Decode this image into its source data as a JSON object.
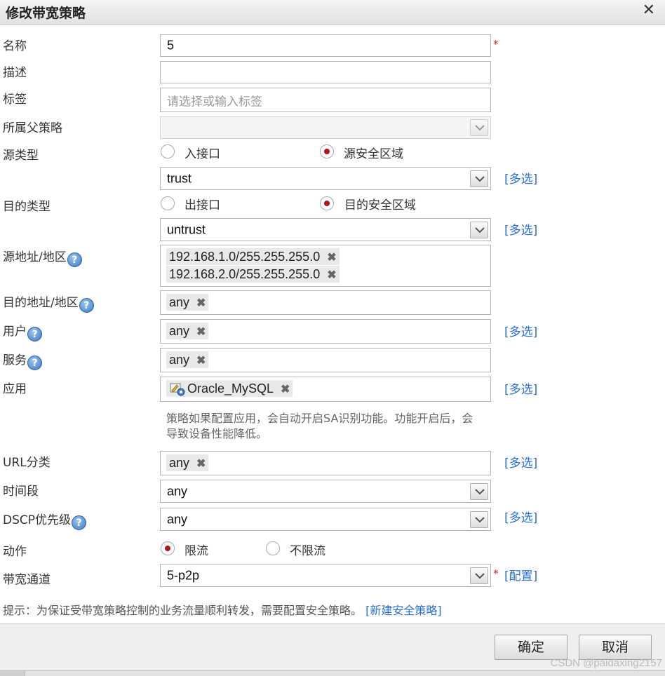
{
  "dialog": {
    "title": "修改带宽策略"
  },
  "labels": {
    "name": "名称",
    "desc": "描述",
    "tags": "标签",
    "parent": "所属父策略",
    "src_type": "源类型",
    "dst_type": "目的类型",
    "src_addr": "源地址/地区",
    "dst_addr": "目的地址/地区",
    "user": "用户",
    "service": "服务",
    "app": "应用",
    "url": "URL分类",
    "time": "时间段",
    "dscp": "DSCP优先级",
    "action": "动作",
    "channel": "带宽通道"
  },
  "fields": {
    "name_value": "5",
    "tags_placeholder": "请选择或输入标签",
    "src_zone": "trust",
    "dst_zone": "untrust",
    "src_addrs": [
      "192.168.1.0/255.255.255.0",
      "192.168.2.0/255.255.255.0"
    ],
    "dst_addr": "any",
    "user": "any",
    "service": "any",
    "app": "Oracle_MySQL",
    "url": "any",
    "time": "any",
    "dscp": "any",
    "channel": "5-p2p"
  },
  "radios": {
    "src_iface": "入接口",
    "src_zone": "源安全区域",
    "dst_iface": "出接口",
    "dst_zone": "目的安全区域",
    "limit": "限流",
    "nolimit": "不限流"
  },
  "help_glyph": "?",
  "required_mark": "*",
  "multi_label": "[多选]",
  "config_label": "[配置]",
  "remove_glyph": "✖",
  "app_note": "策略如果配置应用，会自动开启SA识别功能。功能开启后，会导致设备性能降低。",
  "hint": {
    "text": "提示：为保证受带宽策略控制的业务流量顺利转发，需要配置安全策略。",
    "link": "[新建安全策略]"
  },
  "buttons": {
    "ok": "确定",
    "cancel": "取消"
  },
  "watermark": "CSDN @paidaxing2157",
  "colors": {
    "accent": "#2a6fcf",
    "required": "#e02020",
    "radio_on": "#b3141a"
  },
  "icons": {
    "close": "close-icon",
    "help": "help-icon",
    "dropdown": "chevron-down-icon",
    "app": "app-icon"
  }
}
